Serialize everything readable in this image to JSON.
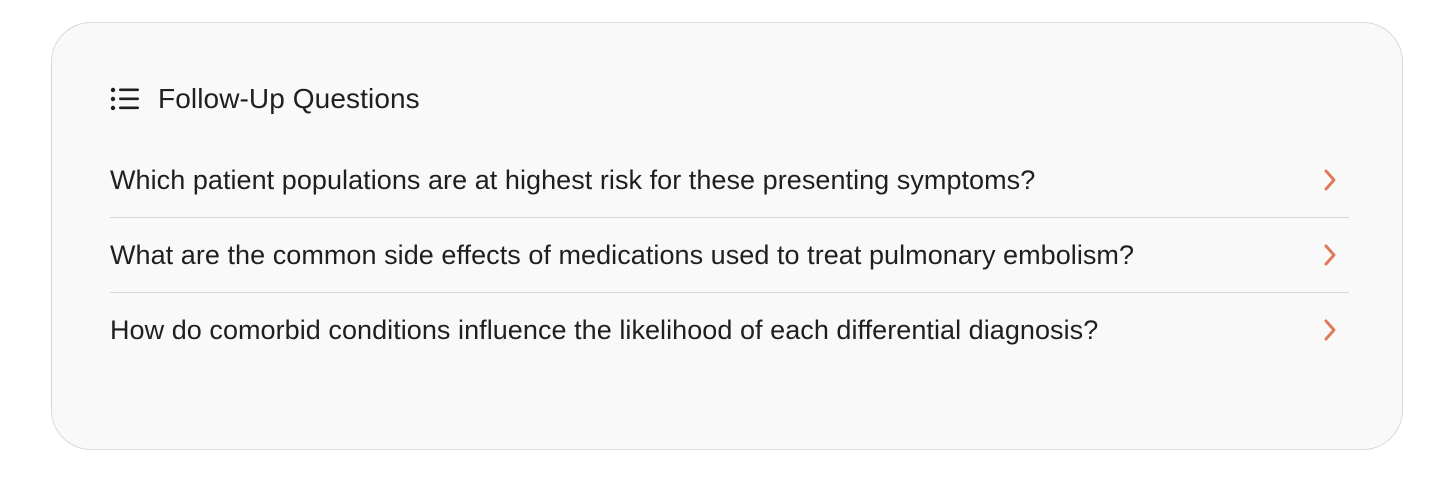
{
  "panel": {
    "title": "Follow-Up Questions",
    "icon": "list-icon"
  },
  "questions": [
    {
      "text": "Which patient populations are at highest risk for these presenting symptoms?",
      "icon": "chevron-right-icon"
    },
    {
      "text": "What are the common side effects of medications used to treat pulmonary embolism?",
      "icon": "chevron-right-icon"
    },
    {
      "text": "How do comorbid conditions influence the likelihood of each differential diagnosis?",
      "icon": "chevron-right-icon"
    }
  ],
  "colors": {
    "accent": "#e07b5a",
    "text": "#1f1f1f",
    "card_background": "#f9f9f9",
    "border": "#d9d9d9",
    "divider": "#d6d6d6"
  }
}
